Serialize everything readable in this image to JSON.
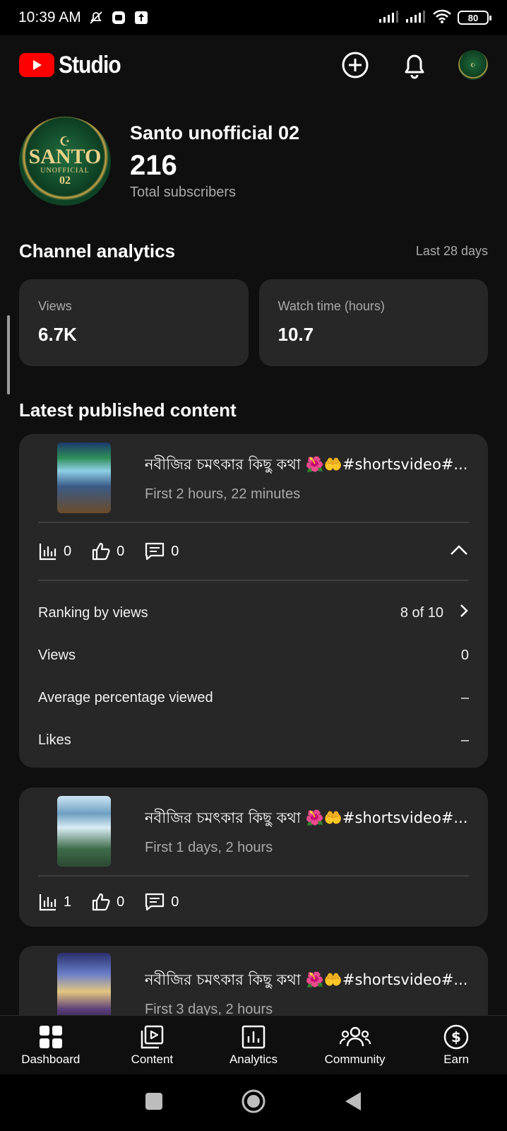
{
  "status_bar": {
    "time": "10:39 AM",
    "battery": "80"
  },
  "app": {
    "logo_text": "Studio"
  },
  "channel": {
    "name": "Santo unofficial 02",
    "subscribers": "216",
    "subscribers_label": "Total subscribers",
    "avatar_text": {
      "word": "SANTO",
      "sub": "UNOFFICIAL",
      "num": "02"
    }
  },
  "analytics": {
    "title": "Channel analytics",
    "range": "Last 28 days",
    "cards": [
      {
        "label": "Views",
        "value": "6.7K"
      },
      {
        "label": "Watch time (hours)",
        "value": "10.7"
      }
    ]
  },
  "latest": {
    "title": "Latest published content",
    "items": [
      {
        "title": "নবীজির চমৎকার কিছু কথা 🌺🤲#shortsvideo#...",
        "time": "First 2 hours, 22 minutes",
        "views": "0",
        "likes": "0",
        "comments": "0",
        "details": [
          {
            "label": "Ranking by views",
            "value": "8 of 10"
          },
          {
            "label": "Views",
            "value": "0"
          },
          {
            "label": "Average percentage viewed",
            "value": "–"
          },
          {
            "label": "Likes",
            "value": "–"
          }
        ]
      },
      {
        "title": "নবীজির চমৎকার কিছু কথা 🌺🤲#shortsvideo#...",
        "time": "First 1 days, 2 hours",
        "views": "1",
        "likes": "0",
        "comments": "0"
      },
      {
        "title": "নবীজির চমৎকার কিছু কথা 🌺🤲#shortsvideo#...",
        "time": "First 3 days, 2 hours"
      }
    ]
  },
  "bottom_nav": [
    {
      "label": "Dashboard",
      "icon": "dashboard-icon"
    },
    {
      "label": "Content",
      "icon": "content-icon"
    },
    {
      "label": "Analytics",
      "icon": "analytics-icon"
    },
    {
      "label": "Community",
      "icon": "community-icon"
    },
    {
      "label": "Earn",
      "icon": "earn-icon"
    }
  ],
  "colors": {
    "background": "#0f0f0f",
    "card": "#272727",
    "brand_red": "#ff0000",
    "secondary_text": "#aaaaaa"
  }
}
